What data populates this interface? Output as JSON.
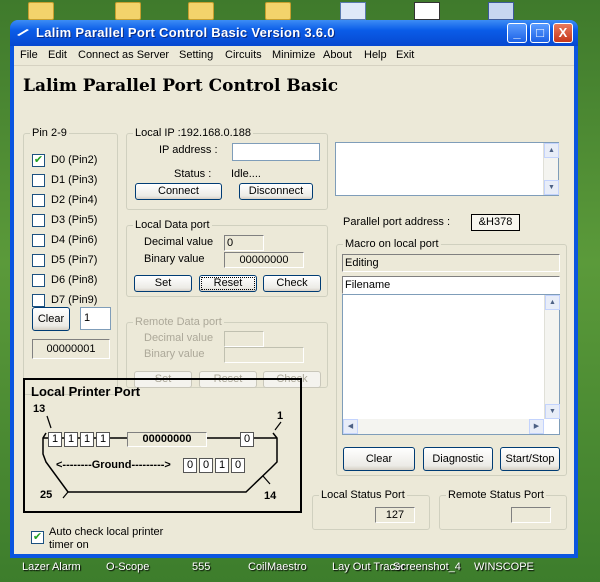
{
  "window": {
    "title": "Lalim Parallel Port Control  Basic   Version 3.6.0",
    "minimize_glyph": "_",
    "maximize_glyph": "□",
    "close_glyph": "X"
  },
  "menu": [
    "File",
    "Edit",
    "Connect as Server",
    "Setting",
    "Circuits",
    "Minimize",
    "About",
    "Help",
    "Exit"
  ],
  "app_heading": "Lalim Parallel Port Control Basic",
  "pins": {
    "group_label": "Pin 2-9",
    "items": [
      {
        "label": "D0  (Pin2)",
        "checked": true
      },
      {
        "label": "D1  (Pin3)",
        "checked": false
      },
      {
        "label": "D2  (Pin4)",
        "checked": false
      },
      {
        "label": "D3  (Pin5)",
        "checked": false
      },
      {
        "label": "D4  (Pin6)",
        "checked": false
      },
      {
        "label": "D5  (Pin7)",
        "checked": false
      },
      {
        "label": "D6  (Pin8)",
        "checked": false
      },
      {
        "label": "D7  (Pin9)",
        "checked": false
      }
    ],
    "clear_label": "Clear",
    "count_value": "1",
    "binary_readout": "00000001"
  },
  "local_ip": {
    "group_label": "Local IP  :192.168.0.188",
    "ip_label": "IP address :",
    "ip_value": "",
    "status_label": "Status :",
    "status_value": "Idle....",
    "connect_label": "Connect",
    "disconnect_label": "Disconnect"
  },
  "local_data": {
    "group_label": "Local Data port",
    "decimal_label": "Decimal value",
    "decimal_value": "0",
    "binary_label": "Binary value",
    "binary_value": "00000000",
    "set_label": "Set",
    "reset_label": "Reset",
    "check_label": "Check"
  },
  "remote_data": {
    "group_label": "Remote Data port",
    "decimal_label": "Decimal value",
    "binary_label": "Binary value",
    "set_label": "Set",
    "reset_label": "Reset",
    "check_label": "Check"
  },
  "parallel_address": {
    "label": "Parallel port address  :",
    "value": "&H378"
  },
  "macro": {
    "group_label": "Macro on local port",
    "editing_label": "Editing",
    "filename_label": "Filename",
    "clear_label": "Clear",
    "diagnostic_label": "Diagnostic",
    "startstop_label": "Start/Stop"
  },
  "printer": {
    "title": "Local Printer Port",
    "pin_13": "13",
    "pin_1": "1",
    "pin_25": "25",
    "pin_14": "14",
    "status_bits": [
      "1",
      "1",
      "1",
      "1"
    ],
    "data_readout": "00000000",
    "top_right_bit": "0",
    "ground_label": "<--------Ground--------->",
    "bottom_bits": [
      "0",
      "0",
      "1",
      "0"
    ]
  },
  "auto_check": {
    "label_line1": "Auto check local printer",
    "label_line2": "timer on",
    "checked": true
  },
  "local_status": {
    "group_label": "Local Status Port",
    "value": "127"
  },
  "remote_status": {
    "group_label": "Remote Status Port",
    "value": ""
  },
  "taskbar": [
    "Lazer Alarm",
    "O-Scope",
    "555",
    "CoilMaestro",
    "Lay Out Tracer",
    "Screenshot_4",
    "WINSCOPE"
  ],
  "colors": {
    "title_blue": "#0a5ce8",
    "window_face": "#ece9d8",
    "check_green": "#21a121"
  }
}
